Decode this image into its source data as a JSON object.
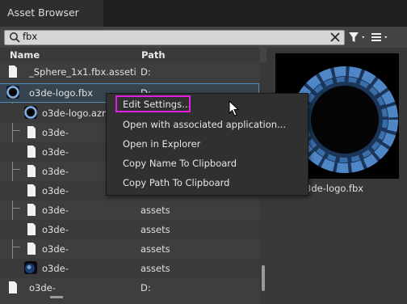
{
  "window": {
    "title": "Asset Browser"
  },
  "search": {
    "value": "fbx",
    "placeholder": ""
  },
  "columns": {
    "name": "Name",
    "path": "Path"
  },
  "rows": [
    {
      "name": "_Sphere_1x1.fbx.asseti",
      "path": "D:",
      "icon": "file-icon"
    },
    {
      "name": "o3de-logo.fbx",
      "path": "D:",
      "icon": "logo-thumbnail"
    },
    {
      "name": "o3de-logo.azm",
      "path": "",
      "icon": "logo-thumbnail"
    },
    {
      "name": "o3de-",
      "path": "",
      "icon": "file-icon"
    },
    {
      "name": "o3de-",
      "path": "",
      "icon": "file-icon"
    },
    {
      "name": "o3de-",
      "path": "",
      "icon": "file-icon"
    },
    {
      "name": "o3de-",
      "path": "",
      "icon": "file-icon"
    },
    {
      "name": "o3de-",
      "path": "assets",
      "icon": "file-icon"
    },
    {
      "name": "o3de-",
      "path": "assets",
      "icon": "file-icon"
    },
    {
      "name": "o3de-",
      "path": "assets",
      "icon": "file-icon"
    },
    {
      "name": "o3de-",
      "path": "assets",
      "icon": "material-thumbnail"
    },
    {
      "name": "o3de-",
      "path": "D:",
      "icon": "file-icon"
    }
  ],
  "context_menu": {
    "items": [
      "Edit Settings...",
      "Open with associated application...",
      "Open in Explorer",
      "Copy Name To Clipboard",
      "Copy Path To Clipboard"
    ],
    "highlight_color": "#e020e0"
  },
  "preview": {
    "label": "o3de-logo.fbx"
  },
  "colors": {
    "selection_outline": "#4f8fc0",
    "accent_blue": "#3a8ee6"
  }
}
